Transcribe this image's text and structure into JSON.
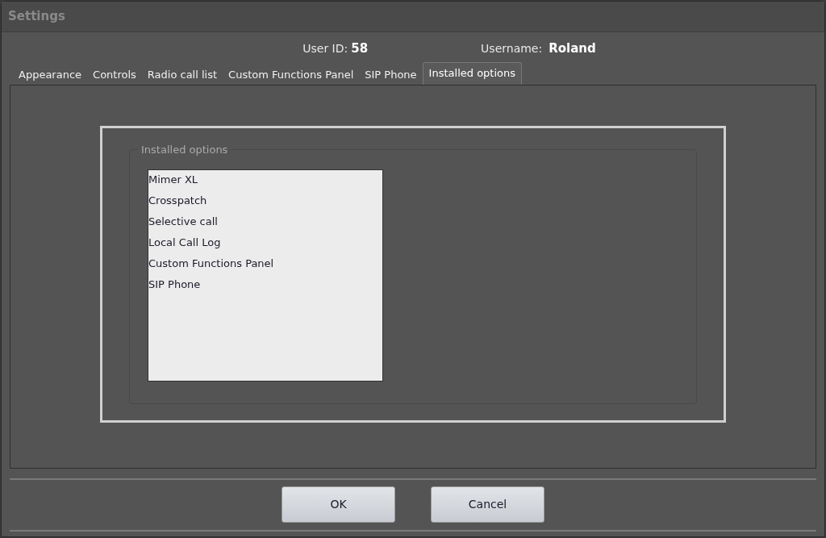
{
  "window": {
    "title": "Settings"
  },
  "user": {
    "id_label": "User ID:",
    "id_value": "58",
    "name_label": "Username:",
    "name_value": "Roland"
  },
  "tabs": [
    {
      "label": "Appearance",
      "selected": false
    },
    {
      "label": "Controls",
      "selected": false
    },
    {
      "label": "Radio call list",
      "selected": false
    },
    {
      "label": "Custom Functions Panel",
      "selected": false
    },
    {
      "label": "SIP Phone",
      "selected": false
    },
    {
      "label": "Installed options",
      "selected": true
    }
  ],
  "group": {
    "title": "Installed options",
    "items": [
      "Mimer XL",
      "Crosspatch",
      "Selective call",
      "Local Call Log",
      "Custom Functions Panel",
      "SIP Phone"
    ]
  },
  "buttons": [
    "OK",
    "Cancel"
  ]
}
